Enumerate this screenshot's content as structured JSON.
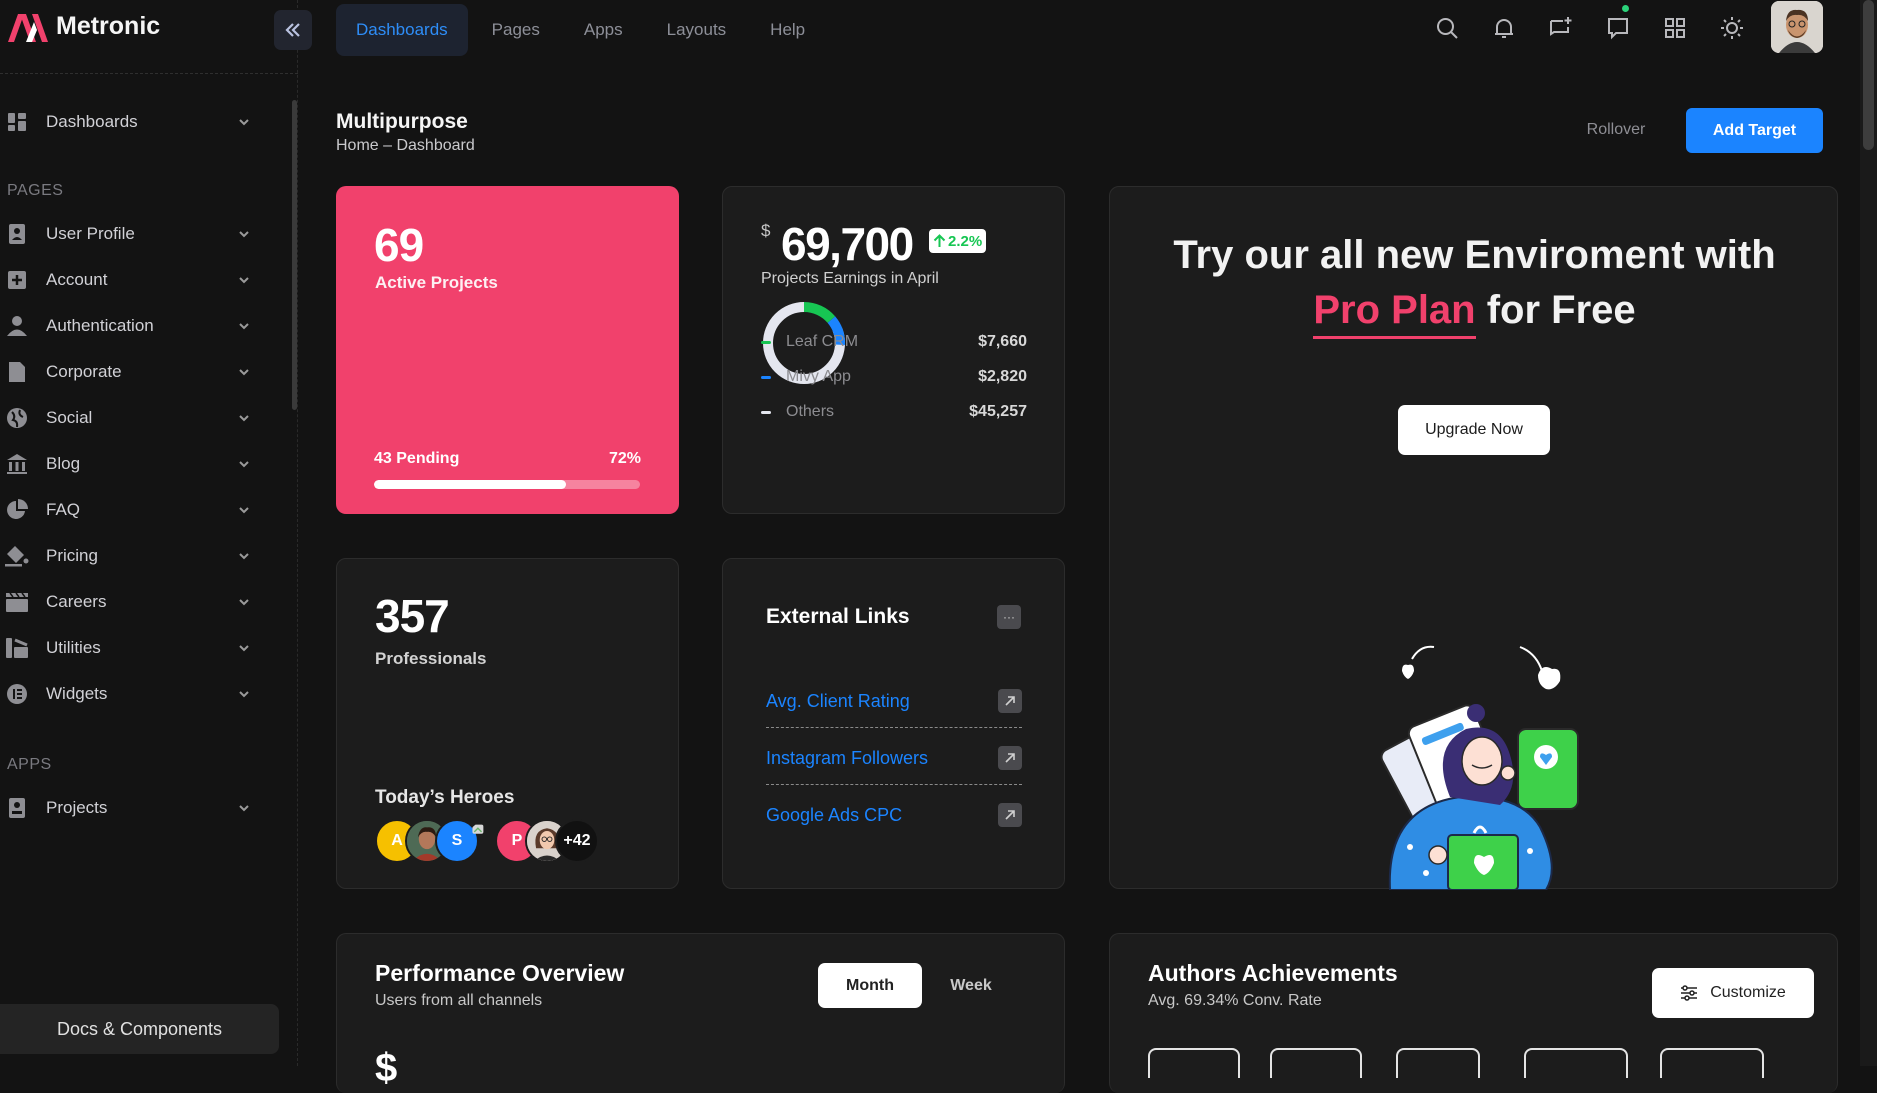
{
  "brand": {
    "name": "Metronic",
    "accent": "#f1416c"
  },
  "topnav": {
    "tabs": [
      "Dashboards",
      "Pages",
      "Apps",
      "Layouts",
      "Help"
    ],
    "active_tab": "Dashboards",
    "icons": [
      "search-icon",
      "bell-icon",
      "chat-add-icon",
      "message-icon",
      "apps-grid-icon",
      "sun-icon"
    ]
  },
  "sidebar": {
    "dashboards": "Dashboards",
    "section_pages": "PAGES",
    "pages": [
      "User Profile",
      "Account",
      "Authentication",
      "Corporate",
      "Social",
      "Blog",
      "FAQ",
      "Pricing",
      "Careers",
      "Utilities",
      "Widgets"
    ],
    "section_apps": "APPS",
    "apps": [
      "Projects"
    ],
    "docs_button": "Docs & Components"
  },
  "page": {
    "title": "Multipurpose",
    "breadcrumb": "Home – Dashboard",
    "rollover": "Rollover",
    "add_target": "Add Target"
  },
  "projects_card": {
    "value": "69",
    "label": "Active Projects",
    "pending": "43 Pending",
    "percent_text": "72%",
    "progress": 0.72,
    "color": "#f1416c"
  },
  "earnings_card": {
    "currency": "$",
    "value": "69,700",
    "change": "2.2%",
    "label": "Projects Earnings in April",
    "items": [
      {
        "name": "Leaf CRM",
        "amount": "$7,660",
        "color": "#17c653"
      },
      {
        "name": "Mivy App",
        "amount": "$2,820",
        "color": "#1b84ff"
      },
      {
        "name": "Others",
        "amount": "$45,257",
        "color": "#e4e6ef"
      }
    ]
  },
  "promo_card": {
    "line1": "Try our all new Enviroment with",
    "highlight": "Pro Plan",
    "line2_rest": " for Free",
    "button": "Upgrade Now"
  },
  "professionals_card": {
    "value": "357",
    "label": "Professionals",
    "heroes_title": "Today’s Heroes",
    "heroes": [
      "A",
      "",
      "S",
      "",
      "P",
      "",
      "+42"
    ]
  },
  "external_links": {
    "title": "External Links",
    "links": [
      "Avg. Client Rating",
      "Instagram Followers",
      "Google Ads CPC"
    ]
  },
  "performance": {
    "title": "Performance Overview",
    "subtitle": "Users from all channels",
    "month": "Month",
    "week": "Week",
    "partial_value": "$"
  },
  "authors": {
    "title": "Authors Achievements",
    "subtitle": "Avg. 69.34% Conv. Rate",
    "customize": "Customize"
  }
}
